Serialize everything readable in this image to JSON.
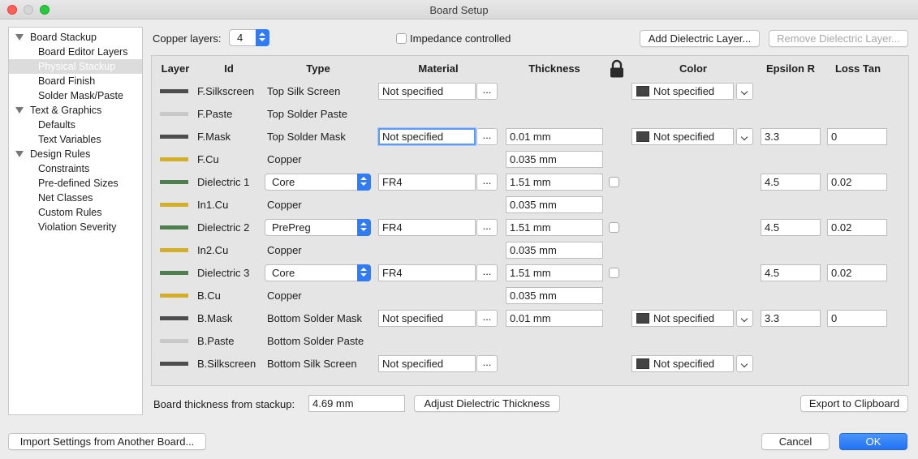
{
  "window": {
    "title": "Board Setup"
  },
  "sidebar": {
    "items": [
      {
        "label": "Board Stackup",
        "level": 0
      },
      {
        "label": "Board Editor Layers",
        "level": 1
      },
      {
        "label": "Physical Stackup",
        "level": 1,
        "selected": true
      },
      {
        "label": "Board Finish",
        "level": 1
      },
      {
        "label": "Solder Mask/Paste",
        "level": 1
      },
      {
        "label": "Text & Graphics",
        "level": 0
      },
      {
        "label": "Defaults",
        "level": 1
      },
      {
        "label": "Text Variables",
        "level": 1
      },
      {
        "label": "Design Rules",
        "level": 0
      },
      {
        "label": "Constraints",
        "level": 1
      },
      {
        "label": "Pre-defined Sizes",
        "level": 1
      },
      {
        "label": "Net Classes",
        "level": 1
      },
      {
        "label": "Custom Rules",
        "level": 1
      },
      {
        "label": "Violation Severity",
        "level": 1
      }
    ]
  },
  "topbar": {
    "copper_layers_label": "Copper layers:",
    "copper_layers_value": "4",
    "impedance_label": "Impedance controlled",
    "add_dielectric": "Add Dielectric Layer...",
    "remove_dielectric": "Remove Dielectric Layer..."
  },
  "table": {
    "headers": {
      "layer": "Layer",
      "id": "Id",
      "type": "Type",
      "material": "Material",
      "thickness": "Thickness",
      "color": "Color",
      "epsilon": "Epsilon R",
      "losstan": "Loss Tan"
    },
    "rows": [
      {
        "color": "#4d4d4d",
        "id": "F.Silkscreen",
        "type": "Top Silk Screen",
        "material": "Not specified",
        "layer_color": "Not specified"
      },
      {
        "color": "#c8c8c8",
        "id": "F.Paste",
        "type": "Top Solder Paste"
      },
      {
        "color": "#4d4d4d",
        "id": "F.Mask",
        "type": "Top Solder Mask",
        "material": "Not specified",
        "thickness": "0.01 mm",
        "layer_color": "Not specified",
        "epsilon": "3.3",
        "losstan": "0",
        "focused": true
      },
      {
        "color": "#d4b02a",
        "id": "F.Cu",
        "type": "Copper",
        "thickness": "0.035 mm"
      },
      {
        "color": "#4f7f4f",
        "id": "Dielectric 1",
        "type_select": "Core",
        "material": "FR4",
        "thickness": "1.51 mm",
        "check": true,
        "epsilon": "4.5",
        "losstan": "0.02"
      },
      {
        "color": "#d4b02a",
        "id": "In1.Cu",
        "type": "Copper",
        "thickness": "0.035 mm"
      },
      {
        "color": "#4f7f4f",
        "id": "Dielectric 2",
        "type_select": "PrePreg",
        "material": "FR4",
        "thickness": "1.51 mm",
        "check": true,
        "epsilon": "4.5",
        "losstan": "0.02"
      },
      {
        "color": "#d4b02a",
        "id": "In2.Cu",
        "type": "Copper",
        "thickness": "0.035 mm"
      },
      {
        "color": "#4f7f4f",
        "id": "Dielectric 3",
        "type_select": "Core",
        "material": "FR4",
        "thickness": "1.51 mm",
        "check": true,
        "epsilon": "4.5",
        "losstan": "0.02"
      },
      {
        "color": "#d4b02a",
        "id": "B.Cu",
        "type": "Copper",
        "thickness": "0.035 mm"
      },
      {
        "color": "#4d4d4d",
        "id": "B.Mask",
        "type": "Bottom Solder Mask",
        "material": "Not specified",
        "thickness": "0.01 mm",
        "layer_color": "Not specified",
        "epsilon": "3.3",
        "losstan": "0"
      },
      {
        "color": "#c8c8c8",
        "id": "B.Paste",
        "type": "Bottom Solder Paste"
      },
      {
        "color": "#4d4d4d",
        "id": "B.Silkscreen",
        "type": "Bottom Silk Screen",
        "material": "Not specified",
        "layer_color": "Not specified"
      }
    ],
    "dots": "..."
  },
  "bottom": {
    "board_thickness_label": "Board thickness from stackup:",
    "board_thickness_value": "4.69 mm",
    "adjust_button": "Adjust Dielectric Thickness",
    "export_button": "Export to Clipboard"
  },
  "footer": {
    "import_button": "Import Settings from Another Board...",
    "cancel_button": "Cancel",
    "ok_button": "OK"
  }
}
